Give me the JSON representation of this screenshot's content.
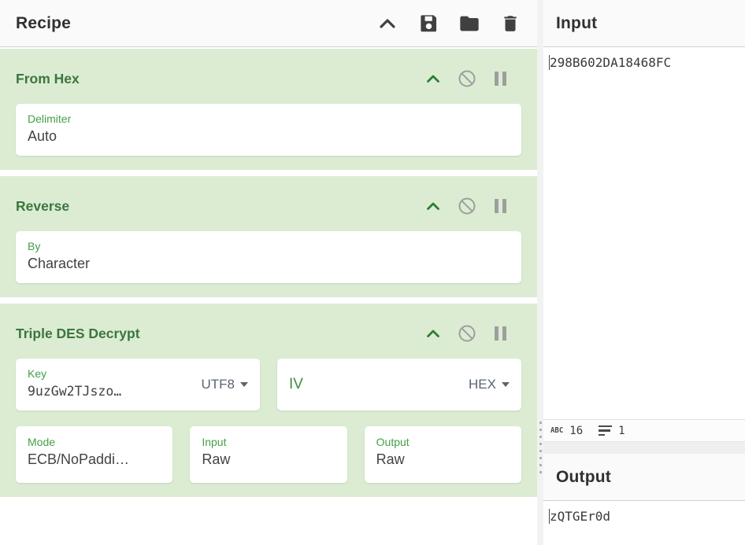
{
  "recipe": {
    "title": "Recipe",
    "header_icons": {
      "collapse": "chevron-up",
      "save": "save-recipe",
      "load": "load-recipe",
      "clear": "clear-recipe"
    },
    "operations": [
      {
        "title": "From Hex",
        "ingredients": [
          {
            "label": "Delimiter",
            "value": "Auto"
          }
        ]
      },
      {
        "title": "Reverse",
        "ingredients": [
          {
            "label": "By",
            "value": "Character"
          }
        ]
      },
      {
        "title": "Triple DES Decrypt",
        "key": {
          "label": "Key",
          "value": "9uzGw2TJszo…",
          "unit": "UTF8"
        },
        "iv": {
          "label": "IV",
          "value": "",
          "unit": "HEX"
        },
        "mode": {
          "label": "Mode",
          "value": "ECB/NoPaddi…"
        },
        "input": {
          "label": "Input",
          "value": "Raw"
        },
        "output": {
          "label": "Output",
          "value": "Raw"
        }
      }
    ]
  },
  "input_pane": {
    "title": "Input",
    "value": "298B602DA18468FC",
    "char_count": "16",
    "line_count": "1"
  },
  "output_pane": {
    "title": "Output",
    "value": "zQTGEr0d"
  },
  "colors": {
    "op_background": "#dcecd3",
    "op_title_green": "#3c763d",
    "ingredient_label_green": "#43a047",
    "icon_gray": "#9e9e9e",
    "icon_dark": "#404040"
  }
}
